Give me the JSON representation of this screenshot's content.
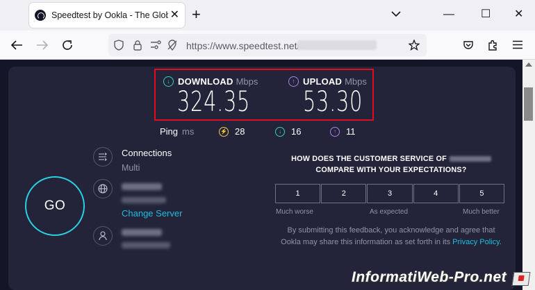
{
  "browser": {
    "tab_title": "Speedtest by Ookla - The Global Broadband Speed Test",
    "tab_close": "✕",
    "new_tab": "+",
    "win_min": "—",
    "win_max": "☐",
    "win_close": "✕",
    "url_protocol": "https://www.",
    "url_host": "speedtest.net/"
  },
  "results": {
    "download_label": "DOWNLOAD",
    "download_unit": "Mbps",
    "download_value": "324.35",
    "upload_label": "UPLOAD",
    "upload_unit": "Mbps",
    "upload_value": "53.30"
  },
  "ping": {
    "label": "Ping",
    "unit": "ms",
    "idle": "28",
    "download": "16",
    "upload": "11"
  },
  "go_label": "GO",
  "connections": {
    "title": "Connections",
    "mode": "Multi"
  },
  "server": {
    "change_label": "Change Server"
  },
  "survey": {
    "line1": "HOW DOES THE CUSTOMER SERVICE OF",
    "line2": "COMPARE WITH YOUR EXPECTATIONS?",
    "ratings": [
      "1",
      "2",
      "3",
      "4",
      "5"
    ],
    "low_label": "Much worse",
    "mid_label": "As expected",
    "high_label": "Much better",
    "disclaimer_1": "By submitting this feedback, you acknowledge and agree that",
    "disclaimer_2": "Ookla may share this information as set forth in its",
    "privacy_link": "Privacy Policy",
    "period": "."
  },
  "watermark": "InformatiWeb-Pro.net",
  "colors": {
    "accent_cyan": "#2bd0e3",
    "download_icon": "#35d0c0",
    "upload_icon": "#b07ee6",
    "ping_icon": "#f2c94c",
    "highlight_box": "#e00d1e"
  },
  "icons": {
    "download": "arrow-down-circle-icon",
    "upload": "arrow-up-circle-icon",
    "ping_idle": "ping-lightning-icon",
    "connections": "connections-icon",
    "server": "globe-icon",
    "user": "user-icon"
  }
}
